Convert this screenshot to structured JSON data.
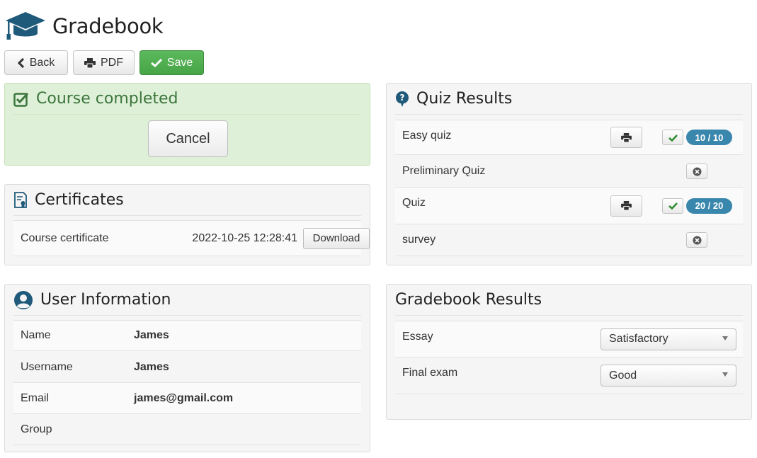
{
  "app": {
    "title": "Gradebook"
  },
  "toolbar": {
    "back_label": "Back",
    "pdf_label": "PDF",
    "save_label": "Save"
  },
  "status": {
    "title": "Course completed",
    "cancel_label": "Cancel"
  },
  "certificates": {
    "title": "Certificates",
    "items": [
      {
        "name": "Course certificate",
        "date": "2022-10-25 12:28:41",
        "download_label": "Download"
      }
    ]
  },
  "user_info": {
    "title": "User Information",
    "rows": [
      {
        "label": "Name",
        "value": "James"
      },
      {
        "label": "Username",
        "value": "James"
      },
      {
        "label": "Email",
        "value": "james@gmail.com"
      },
      {
        "label": "Group",
        "value": ""
      }
    ]
  },
  "quiz_results": {
    "title": "Quiz Results",
    "rows": [
      {
        "name": "Easy quiz",
        "score": "10 / 10",
        "passed": true
      },
      {
        "name": "Preliminary Quiz",
        "score": "",
        "passed": false
      },
      {
        "name": "Quiz",
        "score": "20 / 20",
        "passed": true
      },
      {
        "name": "survey",
        "score": "",
        "passed": false
      }
    ]
  },
  "gradebook_results": {
    "title": "Gradebook Results",
    "rows": [
      {
        "label": "Essay",
        "selected": "Satisfactory"
      },
      {
        "label": "Final exam",
        "selected": "Good"
      }
    ]
  },
  "colors": {
    "success": "#5cb85c",
    "badge": "#3a87ad",
    "icon": "#1f5a7a",
    "completed_text": "#3c763d"
  }
}
